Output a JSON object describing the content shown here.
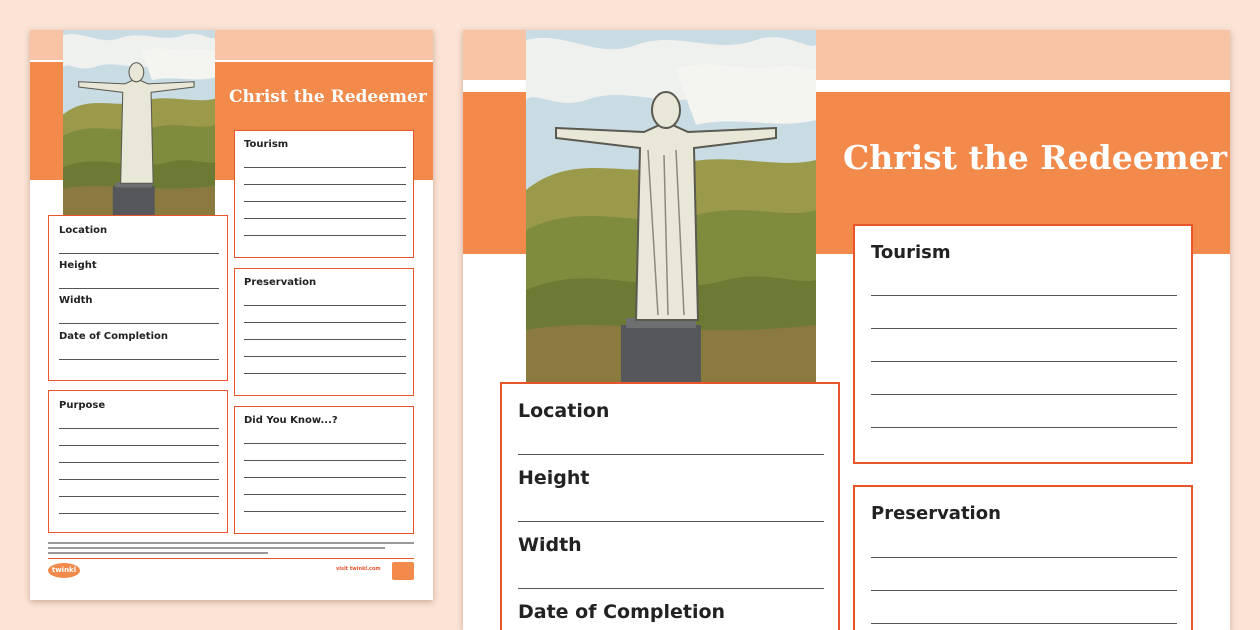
{
  "worksheet": {
    "title": "Christ the Redeemer",
    "fields": {
      "location": "Location",
      "height": "Height",
      "width": "Width",
      "date_of_completion": "Date of Completion",
      "purpose": "Purpose",
      "tourism": "Tourism",
      "preservation": "Preservation",
      "did_you_know": "Did You Know...?"
    },
    "logo_text": "twinkl",
    "website": "visit twinkl.com"
  },
  "colors": {
    "background": "#fbe3d5",
    "band_light": "#f9c4a5",
    "band_orange": "#f28a4c",
    "box_border": "#e8552b"
  }
}
